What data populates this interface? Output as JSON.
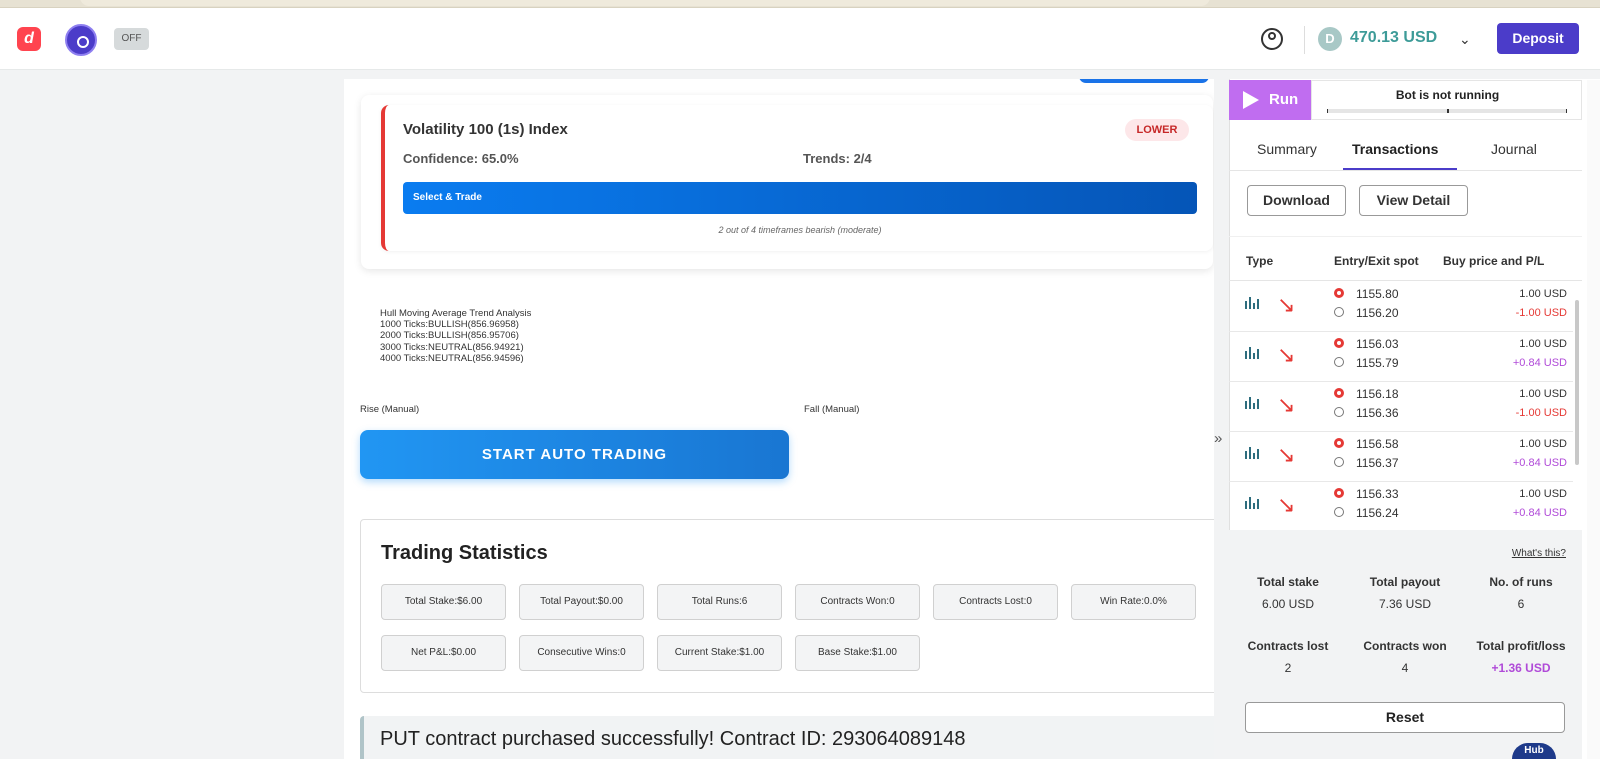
{
  "header": {
    "logo": "d",
    "toggle": "OFF",
    "coin": "D",
    "balance": "470.13 USD",
    "deposit": "Deposit"
  },
  "signal_card": {
    "title": "Volatility 100 (1s) Index",
    "badge": "LOWER",
    "confidence": "Confidence: 65.0%",
    "trends": "Trends: 2/4",
    "select_trade": "Select & Trade",
    "note": "2 out of 4 timeframes bearish (moderate)"
  },
  "hull": {
    "title": "Hull Moving Average Trend Analysis",
    "lines": [
      "1000 Ticks:BULLISH(856.96958)",
      "2000 Ticks:BULLISH(856.95706)",
      "3000 Ticks:NEUTRAL(856.94921)",
      "4000 Ticks:NEUTRAL(856.94596)"
    ]
  },
  "manual": {
    "rise": "Rise (Manual)",
    "fall": "Fall (Manual)",
    "auto_button": "START AUTO TRADING"
  },
  "stats": {
    "title": "Trading Statistics",
    "chips": [
      "Total Stake:$6.00",
      "Total Payout:$0.00",
      "Total Runs:6",
      "Contracts Won:0",
      "Contracts Lost:0",
      "Win Rate:0.0%",
      "Net P&L:$0.00",
      "Consecutive Wins:0",
      "Current Stake:$1.00",
      "Base Stake:$1.00"
    ]
  },
  "banner": {
    "text": "PUT contract purchased successfully! Contract ID: 293064089148"
  },
  "bot": {
    "run": "Run",
    "status": "Bot is not running",
    "collapse": "»"
  },
  "tabs": [
    "Summary",
    "Transactions",
    "Journal"
  ],
  "actions": {
    "download": "Download",
    "view_detail": "View Detail"
  },
  "table": {
    "headers": [
      "Type",
      "Entry/Exit spot",
      "Buy price and P/L"
    ],
    "rows": [
      {
        "entry": "1155.80",
        "exit": "1156.20",
        "buy": "1.00 USD",
        "pl": "-1.00 USD",
        "pl_sign": "neg"
      },
      {
        "entry": "1156.03",
        "exit": "1155.79",
        "buy": "1.00 USD",
        "pl": "+0.84 USD",
        "pl_sign": "pos"
      },
      {
        "entry": "1156.18",
        "exit": "1156.36",
        "buy": "1.00 USD",
        "pl": "-1.00 USD",
        "pl_sign": "neg"
      },
      {
        "entry": "1156.58",
        "exit": "1156.37",
        "buy": "1.00 USD",
        "pl": "+0.84 USD",
        "pl_sign": "pos"
      },
      {
        "entry": "1156.33",
        "exit": "1156.24",
        "buy": "1.00 USD",
        "pl": "+0.84 USD",
        "pl_sign": "pos"
      }
    ]
  },
  "summary": {
    "whats_this": "What's this?",
    "total_stake_label": "Total stake",
    "total_stake": "6.00 USD",
    "total_payout_label": "Total payout",
    "total_payout": "7.36 USD",
    "runs_label": "No. of runs",
    "runs": "6",
    "lost_label": "Contracts lost",
    "lost": "2",
    "won_label": "Contracts won",
    "won": "4",
    "pl_label": "Total profit/loss",
    "pl": "+1.36 USD",
    "reset": "Reset"
  },
  "help": "Hub",
  "colors": {
    "brand": "#4b3cc9",
    "run": "#c06df0",
    "loss": "#e53935",
    "profit": "#b04ad8",
    "balance": "#3d9b98"
  }
}
